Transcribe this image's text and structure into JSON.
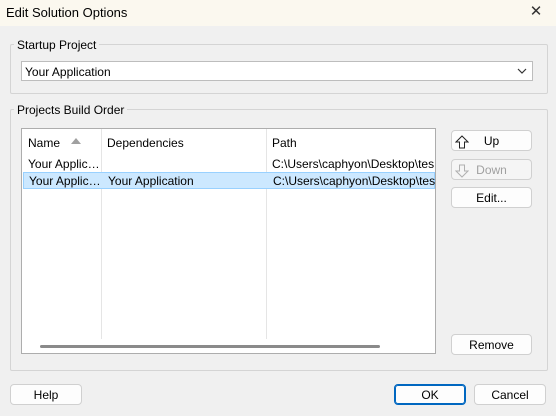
{
  "window": {
    "title": "Edit Solution Options",
    "close_glyph": "✕"
  },
  "startup": {
    "group_label": "Startup Project",
    "selected": "Your Application"
  },
  "build_order": {
    "group_label": "Projects Build Order",
    "columns": [
      "Name",
      "Dependencies",
      "Path"
    ],
    "rows": [
      {
        "name": "Your Applic…",
        "dependencies": "",
        "path": "C:\\Users\\caphyon\\Desktop\\test sc"
      },
      {
        "name": "Your Applic…",
        "dependencies": "Your Application",
        "path": "C:\\Users\\caphyon\\Desktop\\test sc"
      }
    ],
    "selected_row": 1
  },
  "side_buttons": {
    "up": "Up",
    "down": "Down",
    "edit": "Edit...",
    "remove": "Remove"
  },
  "footer": {
    "help": "Help",
    "ok": "OK",
    "cancel": "Cancel"
  },
  "icons": {
    "close": "close-icon",
    "up": "arrow-up-icon",
    "down": "arrow-down-icon",
    "dropdown": "chevron-down-icon",
    "sort": "sort-ascending-icon"
  },
  "colors": {
    "selection_bg": "#cce8ff",
    "selection_border": "#99d1ff",
    "default_button_border": "#0067c0",
    "titlebar_bg": "#fbf8ef"
  }
}
